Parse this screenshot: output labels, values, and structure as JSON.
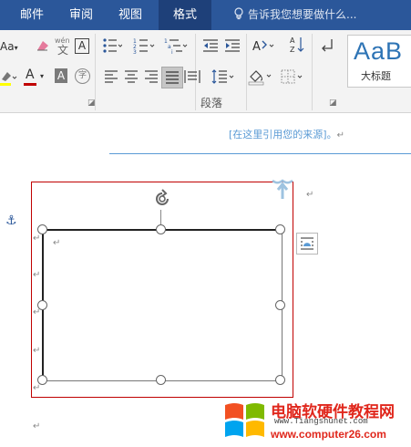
{
  "tabs": [
    {
      "label": "邮件",
      "active": false
    },
    {
      "label": "审阅",
      "active": false
    },
    {
      "label": "视图",
      "active": false
    },
    {
      "label": "格式",
      "active": true
    }
  ],
  "tell_me": {
    "placeholder": "告诉我您想要做什么..."
  },
  "ribbon": {
    "font_size_label": "Aa",
    "phonetic_char": "文",
    "phonetic_top": "wén",
    "border_char": "A",
    "clear_char": "A",
    "shade_char": "A",
    "enclose_char": "字",
    "font_color_char": "A",
    "paragraph_group_label": "段落",
    "style_preview": "AaB",
    "style_name": "大标题",
    "sort_label": "A↓Z",
    "para_mark": "↵"
  },
  "colors": {
    "tab_bar": "#2b579a",
    "font_color_underline": "#c00000",
    "highlight_underline": "#ffff00",
    "citation_text": "#5b9bd5",
    "selection_border": "#c00000",
    "watermark_red": "#e0271c"
  },
  "document": {
    "citation_text": "[在这里引用您的来源]。",
    "para_mark": "↵"
  },
  "watermark": {
    "title": "电脑软硬件教程网",
    "url_top": "www.Tiangshunet.com",
    "url_bottom": "www.computer26.com"
  }
}
